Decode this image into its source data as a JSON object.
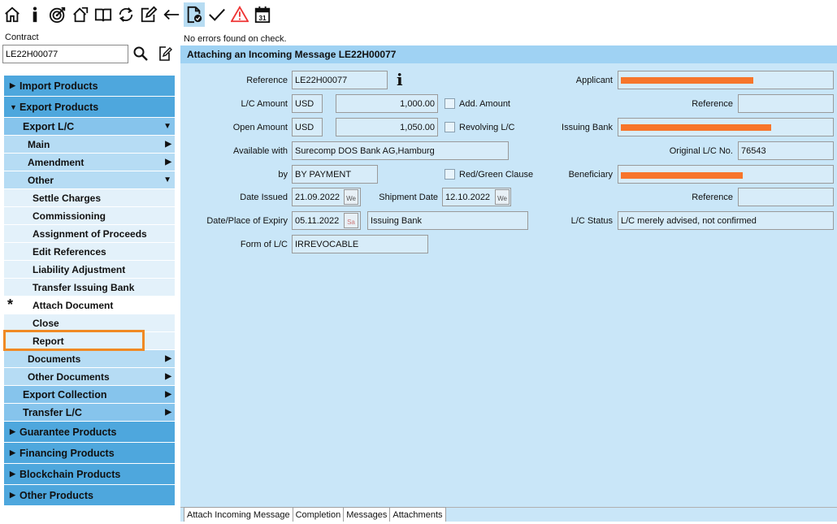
{
  "toolbar": {
    "icons": [
      "home-icon",
      "info-icon",
      "target-icon",
      "house-arrow-icon",
      "book-icon",
      "refresh-icon",
      "edit-icon",
      "back-arrow-icon",
      "document-check-icon",
      "checkmark-icon",
      "warning-icon",
      "calendar-icon"
    ],
    "calendar_day": "31"
  },
  "contract": {
    "label": "Contract",
    "value": "LE22H00077"
  },
  "nav": {
    "import_products": "Import Products",
    "export_products": "Export Products",
    "export_lc": "Export L/C",
    "main": "Main",
    "amendment": "Amendment",
    "other": "Other",
    "other_items": [
      "Settle Charges",
      "Commissioning",
      "Assignment of Proceeds",
      "Edit References",
      "Liability Adjustment",
      "Transfer Issuing Bank",
      "Attach Document",
      "Close",
      "Report"
    ],
    "documents": "Documents",
    "other_documents": "Other Documents",
    "export_collection": "Export Collection",
    "transfer_lc": "Transfer L/C",
    "guarantee_products": "Guarantee Products",
    "financing_products": "Financing Products",
    "blockchain_products": "Blockchain Products",
    "other_products": "Other Products",
    "selected_marker": "*"
  },
  "main": {
    "status": "No errors found on check.",
    "title": "Attaching an Incoming Message LE22H00077",
    "fields": {
      "reference_label": "Reference",
      "reference_value": "LE22H00077",
      "lc_amount_label": "L/C Amount",
      "lc_amount_ccy": "USD",
      "lc_amount_value": "1,000.00",
      "add_amount_label": "Add. Amount",
      "open_amount_label": "Open Amount",
      "open_amount_ccy": "USD",
      "open_amount_value": "1,050.00",
      "revolving_label": "Revolving L/C",
      "available_with_label": "Available with",
      "available_with_value": "Surecomp DOS Bank AG,Hamburg",
      "by_label": "by",
      "by_value": "BY PAYMENT",
      "red_green_label": "Red/Green Clause",
      "date_issued_label": "Date Issued",
      "date_issued_value": "21.09.2022",
      "date_issued_day": "We",
      "shipment_date_label": "Shipment Date",
      "shipment_date_value": "12.10.2022",
      "shipment_date_day": "We",
      "expiry_label": "Date/Place of Expiry",
      "expiry_value": "05.11.2022",
      "expiry_day": "Sa",
      "expiry_place": "Issuing Bank",
      "form_label": "Form of L/C",
      "form_value": "IRREVOCABLE",
      "applicant_label": "Applicant",
      "applicant_reference_label": "Reference",
      "issuing_bank_label": "Issuing Bank",
      "original_lc_label": "Original L/C No.",
      "original_lc_value": "76543",
      "beneficiary_label": "Beneficiary",
      "beneficiary_reference_label": "Reference",
      "lc_status_label": "L/C Status",
      "lc_status_value": "L/C merely advised, not confirmed"
    },
    "tabs": [
      "Attach Incoming Message",
      "Completion",
      "Messages",
      "Attachments"
    ]
  },
  "colors": {
    "nav_level0": "#4ea7dd",
    "nav_level1": "#86c4ec",
    "nav_level2": "#b6dcf4",
    "nav_level3": "#e3f1fa",
    "panel_bg": "#c9e6f8",
    "selection_outline": "#f08a24",
    "redaction": "#f7752a"
  }
}
